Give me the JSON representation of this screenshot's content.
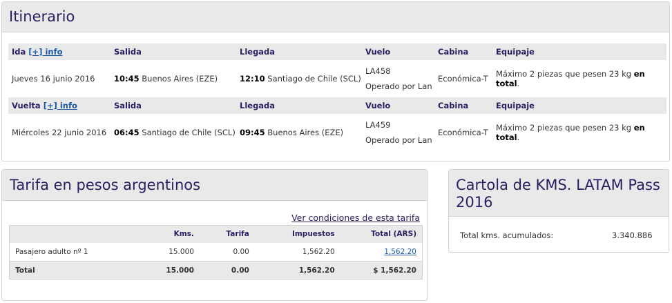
{
  "itinerary": {
    "title": "Itinerario",
    "segments": [
      {
        "direction": "Ida",
        "info_link": "[+] info",
        "headers": {
          "salida": "Salida",
          "llegada": "Llegada",
          "vuelo": "Vuelo",
          "cabina": "Cabina",
          "equipaje": "Equipaje"
        },
        "date": "Jueves 16 junio 2016",
        "dep_time": "10:45",
        "dep_place": "Buenos Aires (EZE)",
        "arr_time": "12:10",
        "arr_place": "Santiago de Chile (SCL)",
        "flight": "LA458",
        "operated_by": "Operado por Lan",
        "cabin": "Económica-T",
        "baggage": "Máximo 2 piezas que pesen 23 kg",
        "baggage_bold": "en total",
        "baggage_end": "."
      },
      {
        "direction": "Vuelta",
        "info_link": "[+] info",
        "headers": {
          "salida": "Salida",
          "llegada": "Llegada",
          "vuelo": "Vuelo",
          "cabina": "Cabina",
          "equipaje": "Equipaje"
        },
        "date": "Miércoles 22 junio 2016",
        "dep_time": "06:45",
        "dep_place": "Santiago de Chile (SCL)",
        "arr_time": "09:45",
        "arr_place": "Buenos Aires (EZE)",
        "flight": "LA459",
        "operated_by": "Operado por Lan",
        "cabin": "Económica-T",
        "baggage": "Máximo 2 piezas que pesen 23 kg",
        "baggage_bold": "en total",
        "baggage_end": "."
      }
    ]
  },
  "fare": {
    "title": "Tarifa en pesos argentinos",
    "conditions_link": "Ver condiciones de esta tarifa",
    "columns": [
      "",
      "Kms.",
      "Tarifa",
      "Impuestos",
      "Total (ARS)"
    ],
    "row": {
      "label": "Pasajero adulto nº 1",
      "kms": "15.000",
      "tarifa": "0.00",
      "impuestos": "1,562.20",
      "total": "1,562.20"
    },
    "total_row": {
      "label": "Total",
      "kms": "15.000",
      "tarifa": "0.00",
      "impuestos": "1,562.20",
      "total": "$ 1,562.20"
    }
  },
  "cartola": {
    "title": "Cartola de KMS. LATAM Pass 2016",
    "label": "Total kms. acumulados:",
    "value": "3.340.886"
  }
}
